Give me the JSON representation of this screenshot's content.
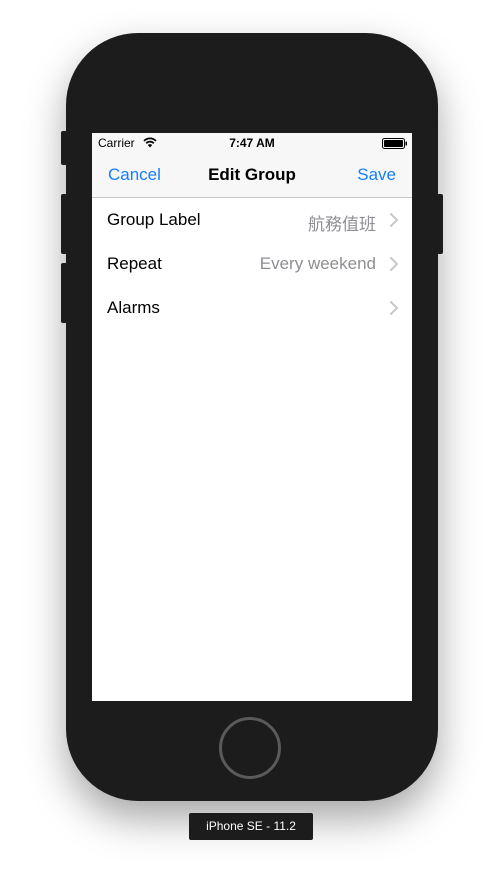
{
  "status_bar": {
    "carrier": "Carrier",
    "time": "7:47 AM",
    "wifi_icon": "wifi-icon",
    "battery_icon": "battery-icon"
  },
  "nav": {
    "cancel_label": "Cancel",
    "title": "Edit Group",
    "save_label": "Save",
    "accent_color": "#147efb"
  },
  "rows": [
    {
      "label": "Group Label",
      "value": "航務值班"
    },
    {
      "label": "Repeat",
      "value": "Every weekend"
    },
    {
      "label": "Alarms",
      "value": ""
    }
  ],
  "device": {
    "label": "iPhone SE - 11.2"
  }
}
